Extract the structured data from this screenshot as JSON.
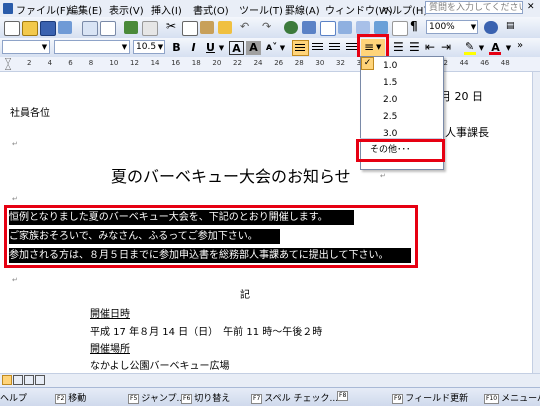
{
  "menu": {
    "items": [
      "ファイル(F)",
      "編集(E)",
      "表示(V)",
      "挿入(I)",
      "書式(O)",
      "ツール(T)",
      "罫線(A)",
      "ウィンドウ(W)",
      "ヘルプ(H)"
    ],
    "ask_placeholder": "質問を入力してください"
  },
  "toolbar": {
    "zoom": "100%"
  },
  "format": {
    "font_size": "10.5",
    "bold": "B",
    "italic": "I",
    "underline": "U",
    "char_border": "A",
    "char_shading": "A",
    "font_color": "A"
  },
  "ruler": {
    "marks": [
      "2",
      "4",
      "6",
      "8",
      "10",
      "12",
      "14",
      "16",
      "18",
      "20",
      "22",
      "24",
      "26",
      "28",
      "30",
      "32",
      "34",
      "36",
      "38",
      "40",
      "42",
      "44",
      "46",
      "48"
    ]
  },
  "line_spacing_menu": {
    "options": [
      "1.0",
      "1.5",
      "2.0",
      "2.5",
      "3.0"
    ],
    "checked": "1.0",
    "more": "その他･･･"
  },
  "document": {
    "addressee": "社員各位",
    "date_fragment": "月 20 日",
    "dept_fragment": "人事課長",
    "title": "夏のバーベキュー大会のお知らせ",
    "para_lines": [
      "恒例となりました夏のバーベキュー大会を、下記のとおり開催します。",
      "ご家族おそろいで、みなさん、ふるってご参加下さい。",
      "参加される方は、８月５日までに参加申込書を総務部人事課あてに提出して下さい。"
    ],
    "ki": "記",
    "date_label": "開催日時",
    "date_value": "平成 17 年８月 14 日（日）　午前 11 時～午後２時",
    "place_label": "開催場所",
    "place_value": "なかよし公園バーベキュー広場"
  },
  "status": {
    "fkeys": [
      {
        "key": "F1",
        "label": "ヘルプ"
      },
      {
        "key": "F2",
        "label": "移動"
      },
      {
        "key": "F5",
        "label": "ジャンプ..."
      },
      {
        "key": "F6",
        "label": "切り替え"
      },
      {
        "key": "F7",
        "label": "スペル チェック..."
      },
      {
        "key": "F8",
        "label": ""
      },
      {
        "key": "F9",
        "label": "フィールド更新"
      },
      {
        "key": "F10",
        "label": "メニューバー"
      }
    ]
  },
  "colors": {
    "highlight": "#e60012",
    "selection": "#000000",
    "toolbar": "#d6e0f1"
  }
}
